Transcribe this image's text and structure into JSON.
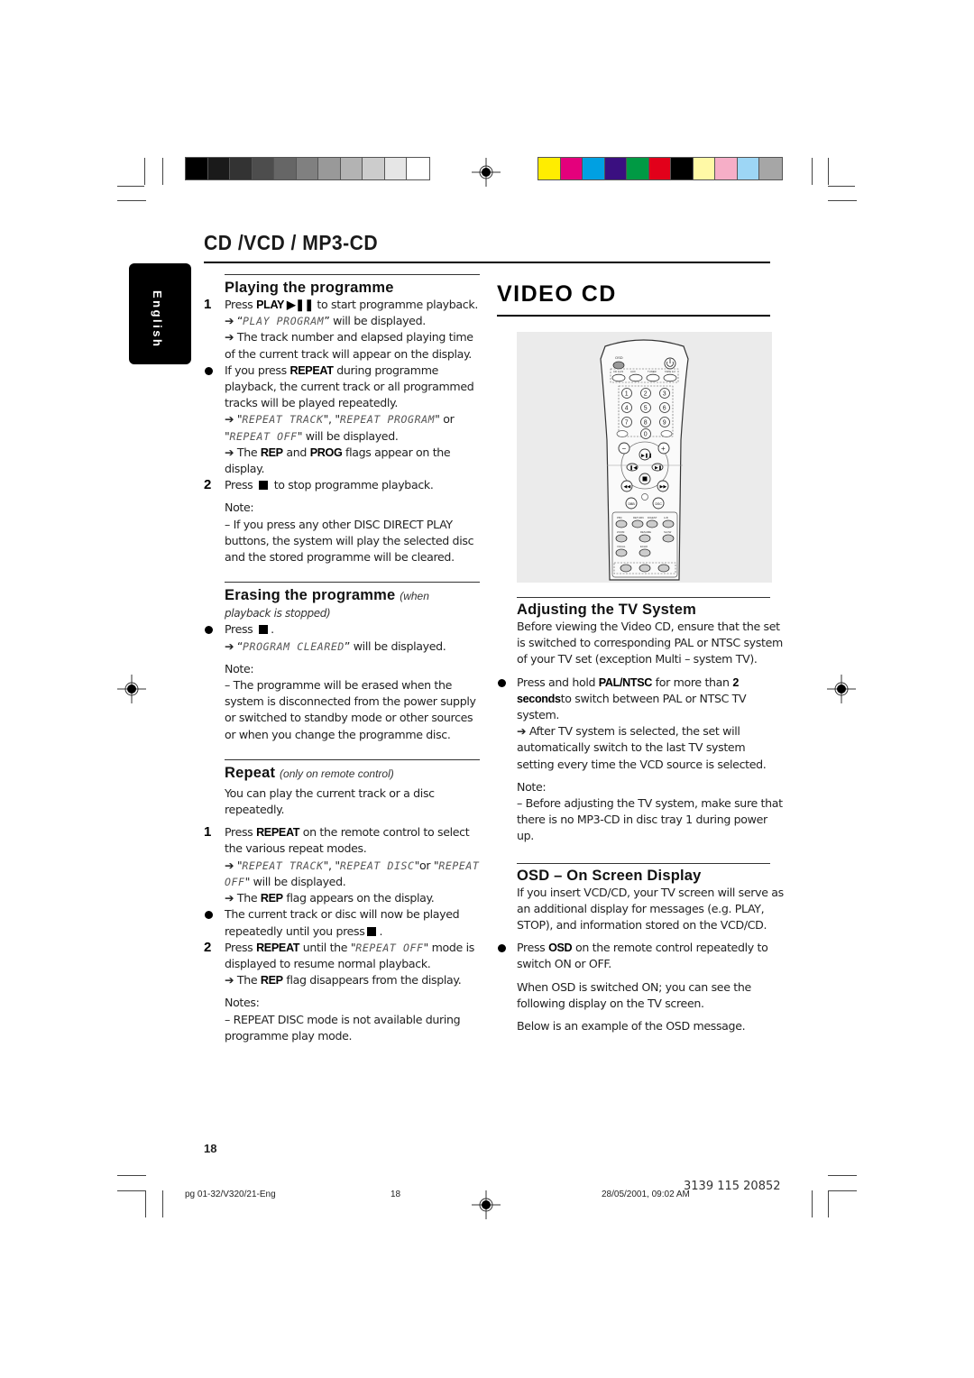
{
  "print_marks": {
    "gray_swatches": [
      "#000000",
      "#1a1a1a",
      "#333333",
      "#4d4d4d",
      "#666666",
      "#808080",
      "#999999",
      "#b3b3b3",
      "#cccccc",
      "#e6e6e6",
      "#ffffff"
    ],
    "color_swatches": [
      "#ffed00",
      "#e4007c",
      "#00a0e2",
      "#3a0f80",
      "#009a44",
      "#e2001a",
      "#000000",
      "#fff9a6",
      "#f6aec7",
      "#9dd6f5",
      "#a6a6a6"
    ]
  },
  "header": {
    "title": "CD /VCD / MP3-CD",
    "language_tab": "English"
  },
  "left_column": {
    "playing": {
      "title": "Playing the programme",
      "step1_marker": "1",
      "step1_pre": "Press ",
      "step1_bold": "PLAY ▶❚❚",
      "step1_post": " to start programme playback.",
      "step1_arrow1_pre": "➔ “",
      "step1_arrow1_lcd": "PLAY PROGRAM",
      "step1_arrow1_post": "” will be displayed.",
      "step1_arrow2": "➔ The track number and elapsed playing time of the current track will appear on the display.",
      "bullet_pre": "If you press ",
      "bullet_bold": "REPEAT",
      "bullet_post": "  during programme playback, the current track or all programmed tracks will be played repeatedly.",
      "bullet_arrow1_pre": "➔ \"",
      "bullet_arrow1_lcd1": "REPEAT TRACK",
      "bullet_arrow1_mid": "\", \"",
      "bullet_arrow1_lcd2": "REPEAT PROGRAM",
      "bullet_arrow1_mid2": "\" or \"",
      "bullet_arrow1_lcd3": "REPEAT OFF",
      "bullet_arrow1_post": "\" will be displayed.",
      "bullet_arrow2_pre": "➔ The ",
      "bullet_arrow2_b1": "REP",
      "bullet_arrow2_mid": " and ",
      "bullet_arrow2_b2": "PROG",
      "bullet_arrow2_post": " flags appear on the display.",
      "step2_marker": "2",
      "step2_pre": "Press ",
      "step2_post": " to stop programme playback.",
      "note_label": "Note:",
      "note_text": "–  If you press any other DISC DIRECT PLAY buttons, the system will play the selected disc and the stored programme will be cleared."
    },
    "erasing": {
      "title": "Erasing the programme",
      "title_sub": "(when",
      "subtitle_line2": "playback is stopped)",
      "bullet_pre": "Press ",
      "bullet_post": ".",
      "arrow_pre": "➔ “",
      "arrow_lcd": "PROGRAM CLEARED",
      "arrow_post": "” will be displayed.",
      "note_label": "Note:",
      "note_text": "–  The programme will be erased when the system is disconnected from the power supply or switched to standby mode or other sources or when you change the programme disc."
    },
    "repeat": {
      "title": "Repeat",
      "title_sub": "(only on remote control)",
      "intro": "You can play the current track or a disc repeatedly.",
      "step1_marker": "1",
      "step1_pre": "Press ",
      "step1_bold": "REPEAT",
      "step1_post": "  on the remote control to select the various repeat modes.",
      "step1_arrow1_pre": "➔ \"",
      "step1_arrow1_lcd1": "REPEAT TRACK",
      "step1_arrow1_mid": "\", \"",
      "step1_arrow1_lcd2": "REPEAT DISC",
      "step1_arrow1_mid2": "\"or \"",
      "step1_arrow1_lcd3": "REPEAT OFF",
      "step1_arrow1_post": "\" will be displayed.",
      "step1_arrow2_pre": "➔ The ",
      "step1_arrow2_bold": "REP",
      "step1_arrow2_post": " flag appears on the display.",
      "bullet_pre": "The current track or disc will now be played repeatedly until you press",
      "bullet_post": ".",
      "step2_marker": "2",
      "step2_pre": "Press ",
      "step2_bold": "REPEAT",
      "step2_mid": "  until the \"",
      "step2_lcd": "REPEAT OFF",
      "step2_post": "\" mode is displayed to resume normal playback.",
      "step2_arrow_pre": "➔ The ",
      "step2_arrow_bold": "REP",
      "step2_arrow_post": " flag disappears from the display.",
      "notes_label": "Notes:",
      "notes_text": "–  REPEAT DISC mode is not available during programme play mode."
    }
  },
  "right_column": {
    "title": "VIDEO CD",
    "remote": {
      "osd_label": "OSD",
      "source_labels": [
        "CD 1/2/3",
        "AUX",
        "TUNER",
        "TAPE 1/2"
      ],
      "digits": [
        "1",
        "2",
        "3",
        "4",
        "5",
        "6",
        "7",
        "8",
        "9",
        "0"
      ],
      "prog_label": "PROG",
      "repeat_label": "REPEAT",
      "volume_minus": "−",
      "volume_plus": "+",
      "play_pause": "▶❚❚",
      "prev": "❚◀",
      "next": "▶❚",
      "stop": "■",
      "rewind": "◀◀",
      "forward": "▶▶",
      "dbb_label": "DBB",
      "dsc_label": "DSC",
      "bottom_labels": [
        "PBC",
        "RETURN",
        "DIGEST",
        "A-B",
        "ZOOM",
        "RESUME",
        "SLOW",
        "VOCAL",
        "ECHO"
      ]
    },
    "tv_system": {
      "title": "Adjusting the TV System",
      "intro": "Before viewing the Video CD, ensure that the set is switched to corresponding PAL or NTSC system of your TV set (exception Multi – system TV).",
      "bullet_pre": "Press and hold ",
      "bullet_bold": "PAL/NTSC",
      "bullet_mid": " for more than ",
      "bullet_bold2": "2 seconds",
      "bullet_post": "to switch between PAL or NTSC TV system.",
      "arrow": "➔ After TV system is selected, the set will automatically switch to the last TV system setting every time the VCD source is selected.",
      "note_label": "Note:",
      "note_text": "–  Before adjusting the TV system, make sure that there is no MP3-CD in disc tray 1 during power up."
    },
    "osd": {
      "title": "OSD – On Screen Display",
      "intro": "If you insert VCD/CD, your TV screen will serve as an additional display for messages (e.g. PLAY, STOP), and information stored on the VCD/CD.",
      "bullet_pre": "Press ",
      "bullet_bold": "OSD",
      "bullet_post": " on the remote control repeatedly to switch ON or OFF.",
      "para1": "When OSD is switched ON; you can see the following display on the TV screen.",
      "para2": "Below is an example of the OSD message."
    }
  },
  "footer": {
    "page_number": "18",
    "file_name": "pg 01-32/V320/21-Eng",
    "file_page": "18",
    "date": "28/05/2001, 09:02 AM",
    "part_number": "3139 115 20852"
  }
}
